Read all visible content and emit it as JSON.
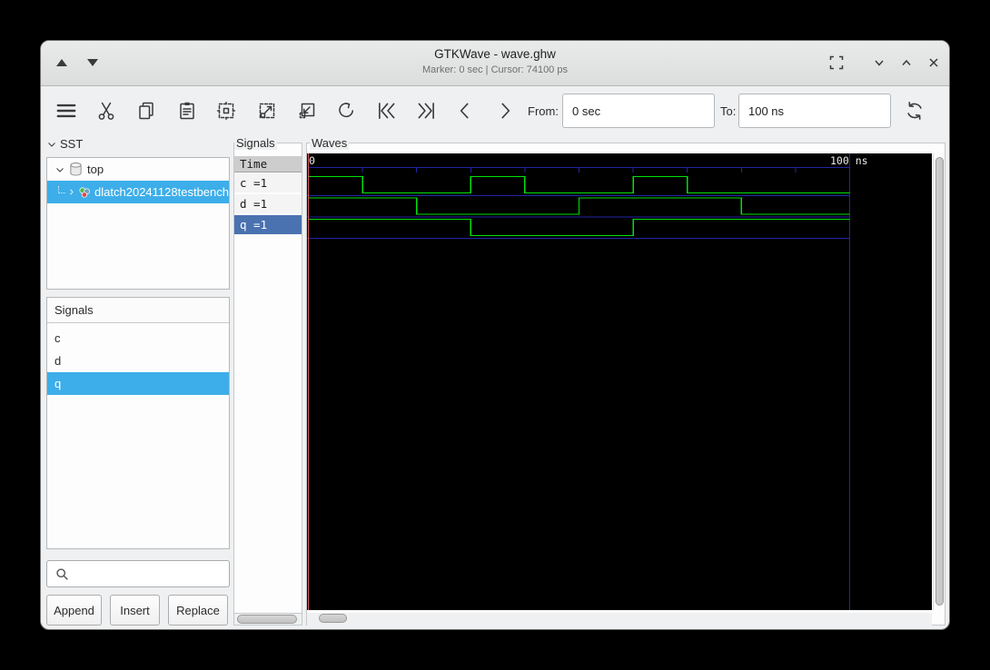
{
  "titlebar": {
    "title": "GTKWave - wave.ghw",
    "status": "Marker: 0 sec  |  Cursor: 74100 ps"
  },
  "toolbar": {
    "icons": [
      "menu",
      "cut",
      "copy",
      "paste",
      "zoom-fit",
      "zoom-in",
      "zoom-out",
      "zoom-undo",
      "fetch-left",
      "fetch-right",
      "shift-left",
      "shift-right",
      "reload"
    ],
    "from_label": "From:",
    "from_value": "0 sec",
    "to_label": "To:",
    "to_value": "100 ns"
  },
  "sst": {
    "header": "SST",
    "tree": [
      {
        "label": "top",
        "icon": "database-cylinder",
        "expanded": true,
        "selected": false
      },
      {
        "label": "dlatch20241128testbench",
        "icon": "module-circles",
        "expanded": false,
        "selected": true
      }
    ],
    "list_header": "Signals",
    "list": [
      "c",
      "d",
      "q"
    ],
    "selected_signal": "q",
    "search_placeholder": "",
    "buttons": [
      "Append",
      "Insert",
      "Replace"
    ]
  },
  "signals_panel": {
    "legend": "Signals",
    "time_header": "Time",
    "rows": [
      "c =1",
      "d =1",
      "q =1"
    ],
    "selected_row": "q =1"
  },
  "waves_panel": {
    "legend": "Waves",
    "time_start_label": "0",
    "time_end_label": "100 ns"
  },
  "chart_data": {
    "type": "line",
    "title": "Waves",
    "x_range": [
      0,
      100
    ],
    "x_unit": "ns",
    "x_tick_interval_ns": 10,
    "visible_tick_labels": [
      "0",
      "100 ns"
    ],
    "marker_time_ns": 0,
    "signals": [
      {
        "name": "c",
        "value_at_marker": 1,
        "transitions": [
          [
            0,
            1
          ],
          [
            10,
            0
          ],
          [
            30,
            1
          ],
          [
            40,
            0
          ],
          [
            60,
            1
          ],
          [
            70,
            0
          ],
          [
            100,
            0
          ]
        ]
      },
      {
        "name": "d",
        "value_at_marker": 1,
        "transitions": [
          [
            0,
            1
          ],
          [
            20,
            0
          ],
          [
            50,
            1
          ],
          [
            80,
            0
          ],
          [
            100,
            0
          ]
        ]
      },
      {
        "name": "q",
        "value_at_marker": 1,
        "transitions": [
          [
            0,
            1
          ],
          [
            30,
            0
          ],
          [
            60,
            1
          ],
          [
            100,
            1
          ]
        ]
      }
    ],
    "colors": {
      "trace": "#00e10a",
      "grid": "#2424a8",
      "marker": "#d95f5f",
      "background": "#000000",
      "selection_blue": "#3daee9",
      "signal_selected_blue": "#4a72b0"
    }
  }
}
